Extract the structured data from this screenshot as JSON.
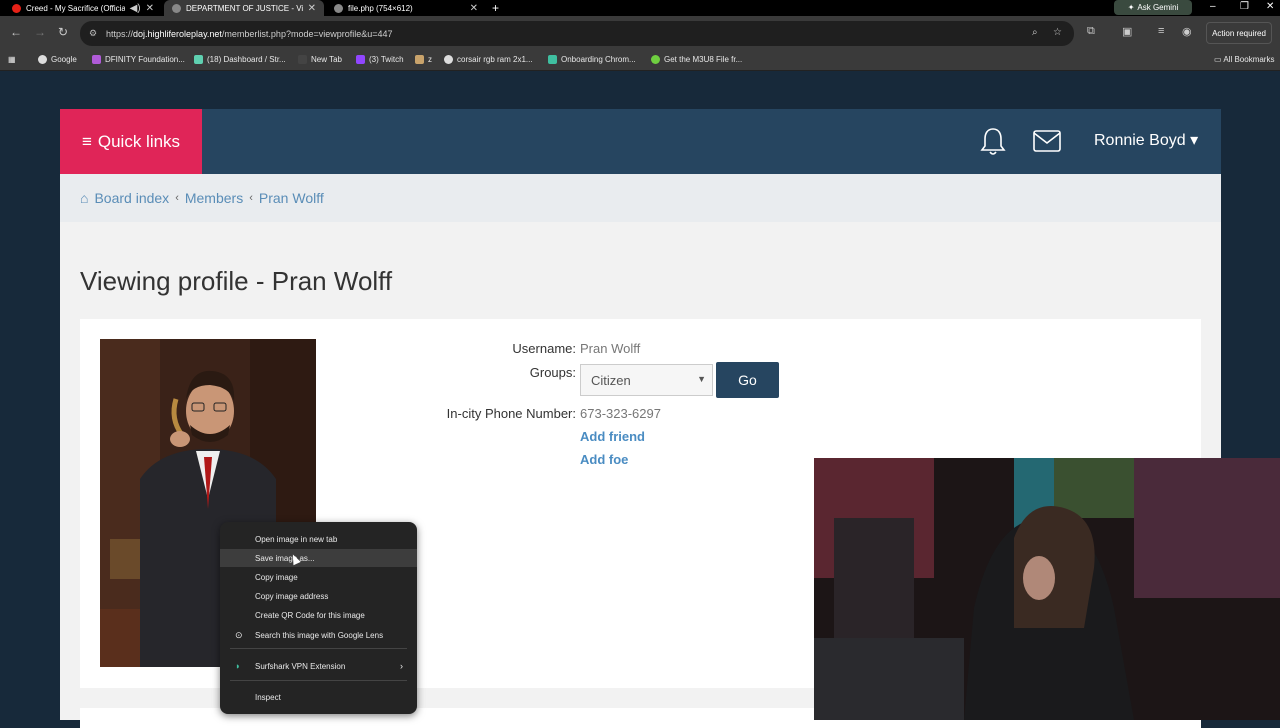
{
  "browser": {
    "tabs": [
      {
        "title": "Creed - My Sacrifice (Officia"
      },
      {
        "title": "DEPARTMENT OF JUSTICE - Vie"
      },
      {
        "title": "file.php (754×612)"
      }
    ],
    "ask_gemini": "Ask Gemini",
    "url_prefix": "https://",
    "url_host": "doj.highliferoleplay.net",
    "url_path": "/memberlist.php?mode=viewprofile&u=447",
    "action_required": "Action required",
    "bookmarks": [
      "Google",
      "DFINITY Foundation...",
      "(18) Dashboard / Str...",
      "New Tab",
      "(3) Twitch",
      "z",
      "corsair rgb ram 2x1...",
      "Onboarding Chrom...",
      "Get the M3U8 File fr..."
    ],
    "all_bookmarks": "All Bookmarks"
  },
  "header": {
    "quick_links": "Quick links",
    "username": "Ronnie Boyd ▾"
  },
  "breadcrumb": {
    "home": "Board index",
    "members": "Members",
    "current": "Pran Wolff"
  },
  "profile": {
    "title": "Viewing profile - Pran Wolff",
    "username_label": "Username:",
    "username_value": "Pran Wolff",
    "groups_label": "Groups:",
    "group_selected": "Citizen",
    "go_button": "Go",
    "phone_label": "In-city Phone Number:",
    "phone_value": "673-323-6297",
    "add_friend": "Add friend",
    "add_foe": "Add foe"
  },
  "context_menu": {
    "items": [
      "Open image in new tab",
      "Save image as...",
      "Copy image",
      "Copy image address",
      "Create QR Code for this image",
      "Search this image with Google Lens",
      "Surfshark VPN Extension",
      "Inspect"
    ]
  },
  "colors": {
    "navbar": "#264560",
    "quick_links": "#e02558",
    "link": "#4a8cc2"
  }
}
